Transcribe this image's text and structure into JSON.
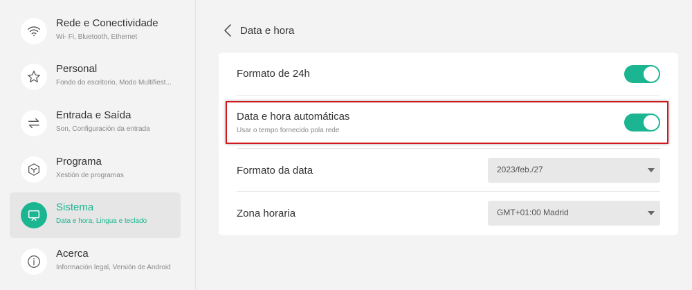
{
  "colors": {
    "accent": "#1bb592",
    "highlight": "#d0191c"
  },
  "sidebar": {
    "items": [
      {
        "icon": "wifi-icon",
        "title": "Rede e Conectividade",
        "subtitle": "Wi- Fi, Bluetooth, Ethernet",
        "active": false
      },
      {
        "icon": "star-icon",
        "title": "Personal",
        "subtitle": "Fondo do escritorio, Modo Multifiest...",
        "active": false
      },
      {
        "icon": "swap-arrows-icon",
        "title": "Entrada e Saída",
        "subtitle": "Son, Configuración da entrada",
        "active": false
      },
      {
        "icon": "cube-icon",
        "title": "Programa",
        "subtitle": "Xestión de programas",
        "active": false
      },
      {
        "icon": "monitor-icon",
        "title": "Sistema",
        "subtitle": "Data e hora, Lingua e teclado",
        "active": true
      },
      {
        "icon": "info-icon",
        "title": "Acerca",
        "subtitle": "Información legal, Versión de Android",
        "active": false
      }
    ]
  },
  "header": {
    "back_icon": "chevron-left-icon",
    "title": "Data e hora"
  },
  "settings": {
    "format_24h": {
      "label": "Formato de 24h",
      "enabled": true
    },
    "auto_datetime": {
      "label": "Data e hora automáticas",
      "sublabel": "Usar o tempo fornecido pola rede",
      "enabled": true
    },
    "date_format": {
      "label": "Formato da data",
      "value": "2023/feb./27"
    },
    "timezone": {
      "label": "Zona horaria",
      "value": "GMT+01:00 Madrid"
    }
  }
}
